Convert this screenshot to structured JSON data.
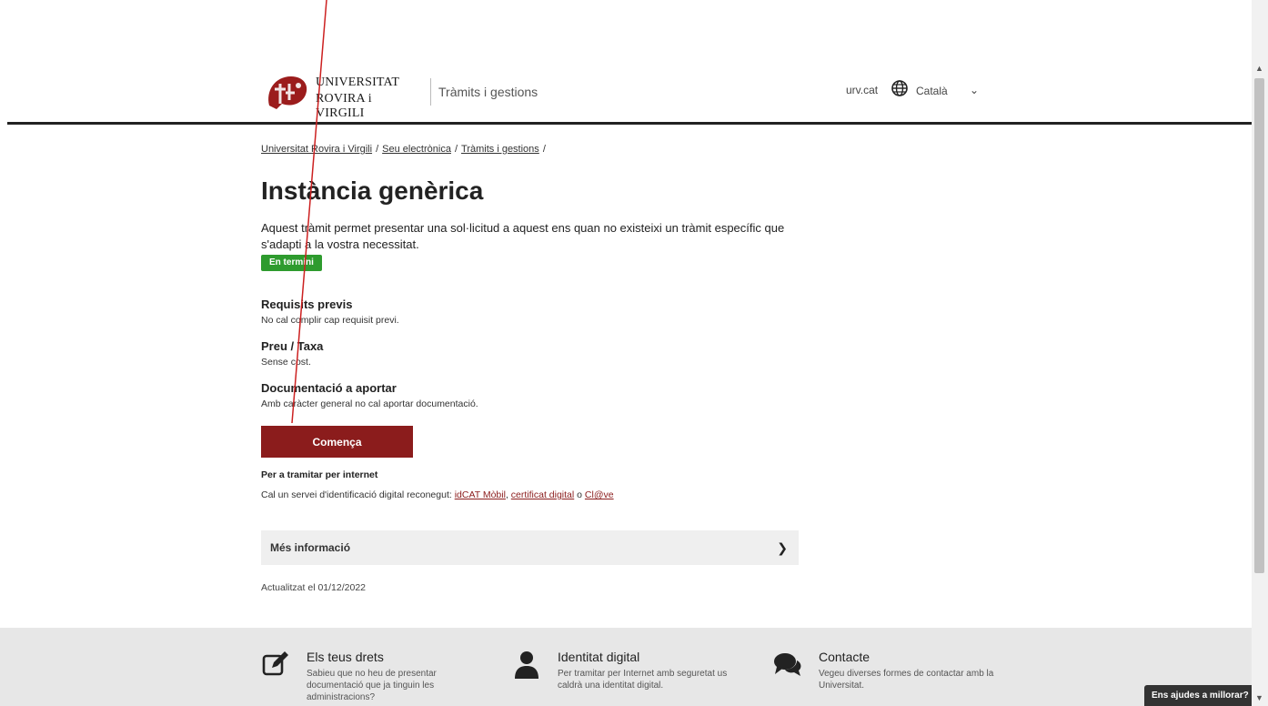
{
  "header": {
    "logo_line1": "UNIVERSITAT",
    "logo_line2": "ROVIRA i VIRGILI",
    "section_title": "Tràmits i gestions",
    "site_link": "urv.cat",
    "language": "Català",
    "globe_icon": "globe-icon",
    "chevron_icon": "chevron-down-icon"
  },
  "breadcrumb": {
    "items": [
      "Universitat Rovira i Virgili",
      "Seu electrònica",
      "Tràmits i gestions"
    ],
    "separator": "/"
  },
  "main": {
    "title": "Instància genèrica",
    "intro": "Aquest tràmit permet presentar una sol·licitud a aquest ens quan no existeixi un tràmit específic que s'adapti a la vostra necessitat.",
    "status_badge": "En termini",
    "sections": [
      {
        "title": "Requisits previs",
        "text": "No cal complir cap requisit previ."
      },
      {
        "title": "Preu / Taxa",
        "text": "Sense cost."
      },
      {
        "title": "Documentació a aportar",
        "text": "Amb caràcter general no cal aportar documentació."
      }
    ],
    "start_button": "Comença",
    "internet_title": "Per a tramitar per internet",
    "internet_prefix": "Cal un servei d'identificació digital reconegut: ",
    "internet_links": [
      "idCAT Mòbil",
      "certificat digital",
      "Cl@ve"
    ],
    "internet_sep1": ", ",
    "internet_sep2": " o ",
    "more_info": "Més informació",
    "updated": "Actualitzat el 01/12/2022"
  },
  "footer": {
    "cards": [
      {
        "title": "Els teus drets",
        "text": "Sabieu que no heu de presentar documentació que ja tinguin les administracions?",
        "icon": "edit-icon"
      },
      {
        "title": "Identitat digital",
        "text": "Per tramitar per Internet amb seguretat us caldrà una identitat digital.",
        "icon": "user-icon"
      },
      {
        "title": "Contacte",
        "text": "Vegeu diverses formes de contactar amb la Universitat.",
        "icon": "chat-icon"
      }
    ]
  },
  "help_button": "Ens ajudes a millorar?",
  "colors": {
    "brand": "#8b1c1c",
    "status_green": "#2e9b2e",
    "footer_bg": "#e7e7e7",
    "annotation_red": "#cc2020"
  }
}
